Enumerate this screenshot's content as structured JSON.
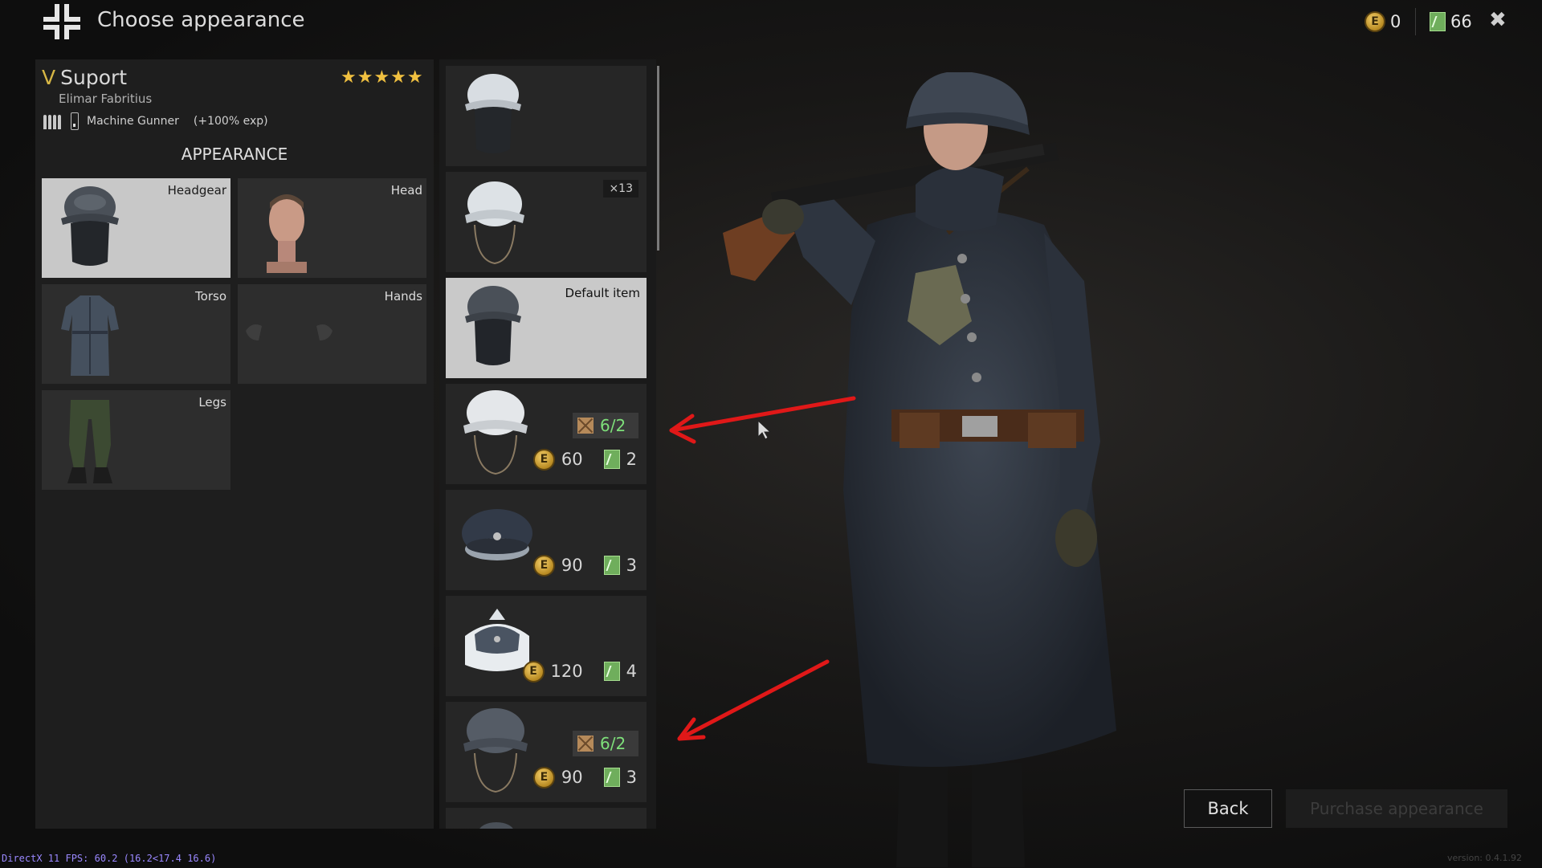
{
  "header": {
    "title": "Choose appearance",
    "gold": "0",
    "tickets": "66"
  },
  "soldier": {
    "rank": "V",
    "class_name": "Suport",
    "full_name": "Elimar Fabritius",
    "stars": "★★★★★",
    "kind": "Machine Gunner",
    "exp": "(+100% exp)"
  },
  "appearance": {
    "title": "APPEARANCE",
    "slots": [
      {
        "label": "Headgear"
      },
      {
        "label": "Head"
      },
      {
        "label": "Torso"
      },
      {
        "label": "Hands"
      },
      {
        "label": "Legs"
      }
    ]
  },
  "items": [
    {
      "icon": "white-cover-helmet-icon"
    },
    {
      "icon": "white-cover-helmet-strap-icon",
      "count": "×13"
    },
    {
      "icon": "steel-helmet-balaclava-icon",
      "label": "Default item"
    },
    {
      "icon": "white-steel-helmet-icon",
      "orders": "6/2",
      "price": "60",
      "tickets": "2"
    },
    {
      "icon": "field-cap-icon",
      "price": "90",
      "tickets": "3"
    },
    {
      "icon": "fur-winter-cap-icon",
      "price": "120",
      "tickets": "4"
    },
    {
      "icon": "grey-steel-helmet-icon",
      "orders": "6/2",
      "price": "90",
      "tickets": "3"
    }
  ],
  "footer": {
    "back": "Back",
    "purchase": "Purchase appearance",
    "fps": "DirectX 11 FPS: 60.2 (16.2<17.4 16.6)",
    "version": "version: 0.4.1.92"
  },
  "colors": {
    "accent_gold": "#d6b645",
    "orders_green": "#7ee07a",
    "annotation_red": "#e01818"
  }
}
